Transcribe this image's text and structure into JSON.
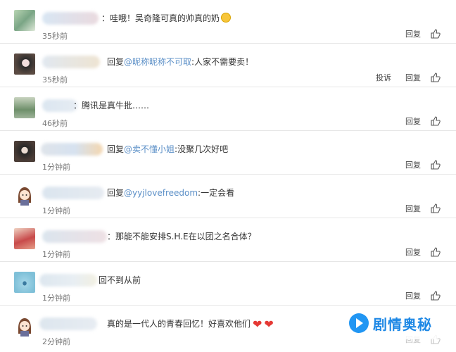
{
  "comments": [
    {
      "text_before": "：哇哦！吴奇隆可真的帅真的奶",
      "link": "",
      "text_after": "",
      "time": "35秒前",
      "report": "",
      "reply": "回复",
      "emoji": "laugh"
    },
    {
      "text_before": "回复",
      "link": "@昵称昵称不可取",
      "text_after": ":人家不需要卖！",
      "time": "35秒前",
      "report": "投诉",
      "reply": "回复",
      "emoji": ""
    },
    {
      "text_before": "：腾讯是真牛批……",
      "link": "",
      "text_after": "",
      "time": "46秒前",
      "report": "",
      "reply": "回复",
      "emoji": ""
    },
    {
      "text_before": "回复",
      "link": "@卖不懂小姐",
      "text_after": ":没聚几次好吧",
      "time": "1分钟前",
      "report": "",
      "reply": "回复",
      "emoji": ""
    },
    {
      "text_before": "回复",
      "link": "@yyjlovefreedom",
      "text_after": ":一定会看",
      "time": "1分钟前",
      "report": "",
      "reply": "回复",
      "emoji": ""
    },
    {
      "text_before": "：那能不能安排S.H.E在以团之名合体？",
      "link": "",
      "text_after": "",
      "time": "1分钟前",
      "report": "",
      "reply": "回复",
      "emoji": ""
    },
    {
      "text_before": "回不到从前",
      "link": "",
      "text_after": "",
      "time": "1分钟前",
      "report": "",
      "reply": "回复",
      "emoji": ""
    },
    {
      "text_before": "真的是一代人的青春回忆！好喜欢他们",
      "link": "",
      "text_after": "",
      "time": "2分钟前",
      "report": "",
      "reply": "回复",
      "emoji": "hearts"
    }
  ],
  "watermark": {
    "text": "剧情奥秘"
  },
  "colors": {
    "link": "#5b8fc7",
    "divider": "#e6e6e6",
    "watermark": "#1e88e5"
  }
}
